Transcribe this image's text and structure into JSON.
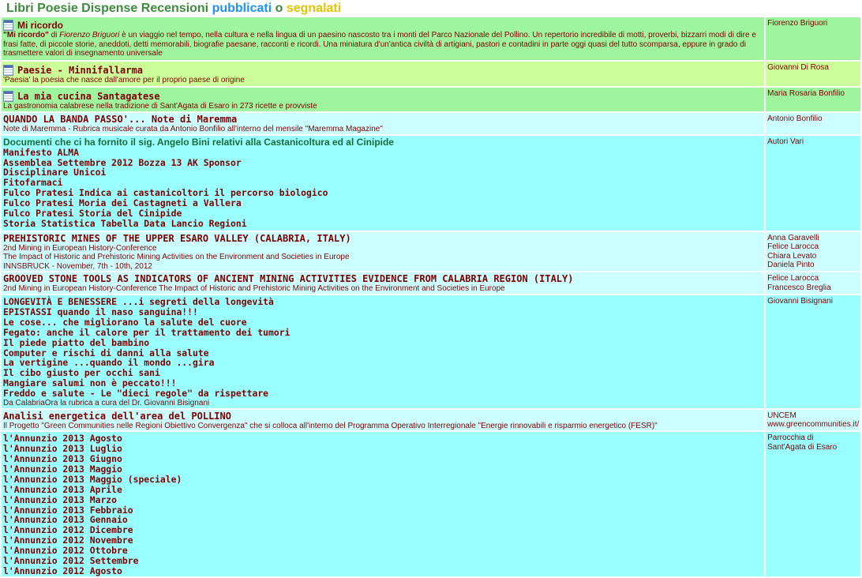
{
  "header": {
    "cat1": "Libri",
    "cat2": "Poesie",
    "cat3": "Dispense",
    "cat4": "Recensioni",
    "pub": "pubblicati",
    "sep": "o",
    "seg": "segnalati"
  },
  "rows": {
    "r1": {
      "title": "Mi ricordo",
      "desc_bold": "\"Mi ricordo\"",
      "desc_di": " di ",
      "desc_author": "Fiorenzo Briguori",
      "desc_rest": " è un viaggio nel tempo, nella cultura e nella lingua di un paesino nascosto tra i monti del Parco Nazionale del Pollino. Un repertorio incredibile di motti, proverbi, bizzarri modi di dire e frasi fatte, di piccole storie, aneddoti, detti memorabili, biografie paesane, racconti e ricordi. Una miniatura d'un'antica civiltà di artigiani, pastori e contadini in parte oggi quasi del tutto scomparsa, eppure in grado di trasmettere valori di insegnamento universale",
      "author": "Fiorenzo Briguori"
    },
    "r2": {
      "title": "Paesie - Minnifallarma",
      "desc": "'Paesia' la poesia che nasce dall'amore per il proprio paese di origine",
      "author": "Giovanni Di Rosa"
    },
    "r3": {
      "title": "La mia cucina Santagatese",
      "desc": "La gastronomia calabrese nella tradizione di Sant'Agata di Esaro in 273 ricette e provviste",
      "author": "Maria Rosaria Bonfilio"
    },
    "r4": {
      "title": "QUANDO LA BANDA PASSO'... Note di Maremma",
      "desc": "Note di Maremma - Rubrica musicale curata da Antonio Bonfilio all'interno del mensile \"Maremma Magazine\"",
      "author": "Antonio Bonfilio"
    },
    "r5": {
      "title": "Documenti che ci ha fornito il sig. Angelo Bini relativi alla Castanicoltura ed al Cinipide",
      "items": [
        "Manifesto ALMA",
        "Assemblea Settembre 2012 Bozza 13 AK Sponsor",
        "Disciplinare Unicoi",
        "Fitofarmaci",
        "Fulco Pratesi Indica ai castanicoltori il percorso biologico",
        "Fulco Pratesi Moria dei Castagneti a Vallera",
        "Fulco Pratesi Storia del Cinipide",
        "Storia Statistica Tabella Data Lancio Regioni"
      ],
      "author": "Autori Vari"
    },
    "r6": {
      "title": "PREHISTORIC MINES OF THE UPPER ESARO VALLEY (CALABRIA, ITALY)",
      "line1": "2nd Mining in European History-Conference",
      "line2": "The Impact of Historic and Prehistoric Mining Activities on the Environment and Societies in Europe",
      "line3": "INNSBRUCK - November, 7th - 10th, 2012",
      "authors": [
        "Anna Garavelli",
        "Felice Larocca",
        "Chiara Levato",
        "Daniela Pinto"
      ]
    },
    "r7": {
      "title": "GROOVED STONE TOOLS AS INDICATORS OF ANCIENT MINING ACTIVITIES EVIDENCE FROM CALABRIA REGION (ITALY)",
      "desc": "2nd Mining in European History-Conference The Impact of Historic and Prehistoric Mining Activities on the Environment and Societies in Europe",
      "authors": [
        "Felice Larocca",
        "Francesco Breglia"
      ]
    },
    "r8": {
      "items": [
        "LONGEVITÀ E BENESSERE ...i segreti della longevità",
        "EPISTASSI quando il naso sanguina!!!",
        "Le cose... che migliorano la salute del cuore",
        "Fegato: anche il calore per il trattamento dei tumori",
        "Il piede piatto del bambino",
        "Computer e rischi di danni alla salute",
        "La vertigine ...quando il mondo ...gira",
        "Il cibo giusto per occhi sani",
        "Mangiare salumi non è peccato!!!",
        "Freddo e salute - Le \"dieci regole\" da rispettare"
      ],
      "desc": "Da CalabriaOra la rubrica a cura del Dr. Giovanni Bisignani",
      "author": "Giovanni Bisignani"
    },
    "r9": {
      "title": "Analisi energetica dell'area del POLLINO",
      "desc": "Il Progetto \"Green Communities nelle Regioni Obiettivo Convergenza\" che si colloca all'interno del Programma Operativo Interregionale \"Energie rinnovabili e risparmio energetico (FESR)\"",
      "authors": [
        "UNCEM",
        "www.greencommunities.it/"
      ]
    },
    "r10": {
      "items": [
        "l'Annunzio 2013 Agosto",
        "l'Annunzio 2013 Luglio",
        "l'Annunzio 2013 Giugno",
        "l'Annunzio 2013 Maggio",
        "l'Annunzio 2013 Maggio (speciale)",
        "l'Annunzio 2013 Aprile",
        "l'Annunzio 2013 Marzo",
        "l'Annunzio 2013 Febbraio",
        "l'Annunzio 2013 Gennaio",
        "l'Annunzio 2012 Dicembre",
        "l'Annunzio 2012 Novembre",
        "l'Annunzio 2012 Ottobre",
        "l'Annunzio 2012 Settembre",
        "l'Annunzio 2012 Agosto"
      ],
      "authors": [
        "Parrocchia di",
        "Sant'Agata di Esaro"
      ]
    }
  },
  "colors": {
    "green_row": "#9ef59e",
    "lime_row": "#ccff99",
    "pale_cyan_row": "#ccffff",
    "cyan_row": "#99ffff",
    "text": "#800000",
    "header_green": "#3d8b3d",
    "header_blue": "#1e90ff",
    "header_yellow": "#e6c300"
  },
  "icons": {
    "book": "document-icon"
  }
}
